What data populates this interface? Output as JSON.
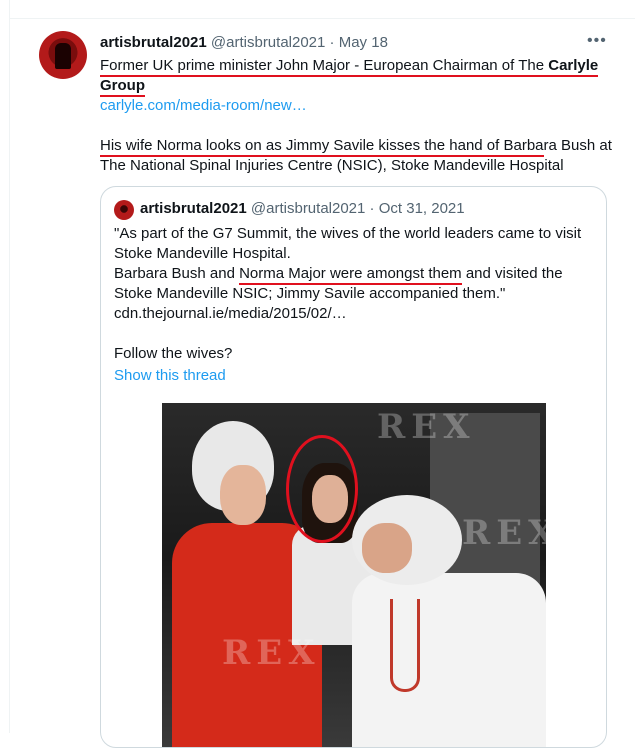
{
  "tweet": {
    "author_name": "artisbrutal2021",
    "author_handle": "@artisbrutal2021",
    "separator": "·",
    "date": "May 18",
    "more_icon": "more-horizontal-icon",
    "line1_a": "Former UK prime minister John Major - European Chairman of The ",
    "line1_bold": "Carlyle",
    "line2_bold": "Group",
    "link": "carlyle.com/media-room/new…",
    "line3_underlined": "His wife Norma looks on as Jimmy Savile kisses the hand of Barba",
    "line3_rest": "ra Bush at",
    "line4": "The National Spinal Injuries Centre (NSIC), Stoke Mandeville Hospital"
  },
  "quote": {
    "author_name": "artisbrutal2021",
    "author_handle": "@artisbrutal2021",
    "separator": "·",
    "date": "Oct 31, 2021",
    "line1": "\"As part of the G7 Summit, the wives of the world leaders came to visit",
    "line2": "Stoke Mandeville Hospital.",
    "line3_a": "Barbara Bush and ",
    "line3_underlined": "Norma Major were amongst them",
    "line3_b": " and visited the",
    "line4": "Stoke Mandeville NSIC; Jimmy Savile accompanied them.\"",
    "line5": "cdn.thejournal.ie/media/2015/02/…",
    "line6": "Follow the wives?",
    "show_thread": "Show this thread",
    "watermark": "REX"
  },
  "colors": {
    "link": "#1d9bf0",
    "annotation": "#e0101e",
    "muted": "#536471"
  }
}
